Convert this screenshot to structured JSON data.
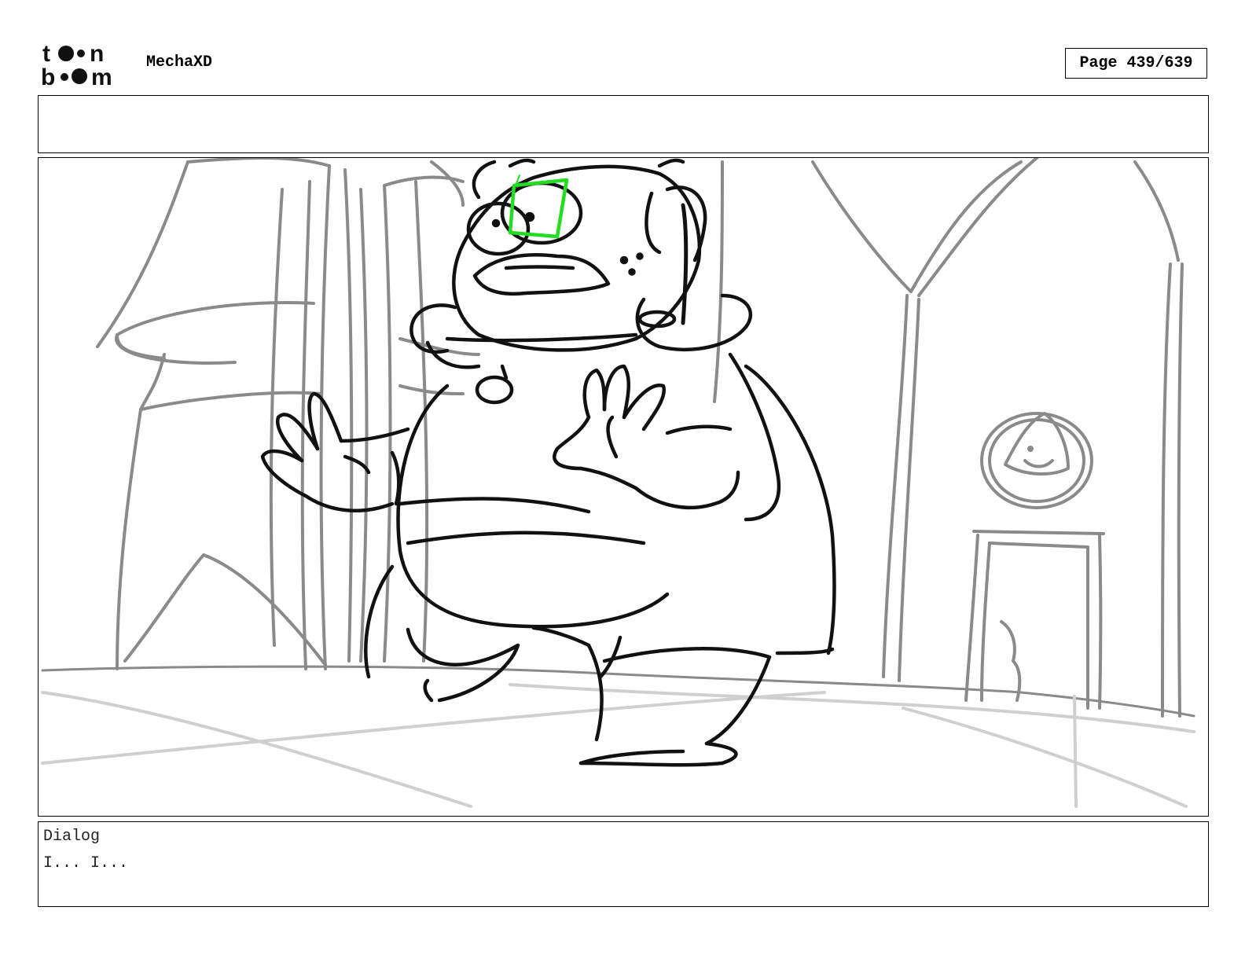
{
  "header": {
    "logo_line1": "toon",
    "logo_line2": "boom",
    "project_title": "MechaXD",
    "page_label": "Page 439/639"
  },
  "notes": {
    "text": ""
  },
  "panel": {
    "description_icon": "storyboard-sketch"
  },
  "dialog": {
    "label": "Dialog",
    "text": "I... I..."
  },
  "colors": {
    "sketch_black": "#111111",
    "sketch_gray": "#8a8a8a",
    "sketch_light_gray": "#cfcfcf",
    "highlight_green": "#22dd22"
  }
}
